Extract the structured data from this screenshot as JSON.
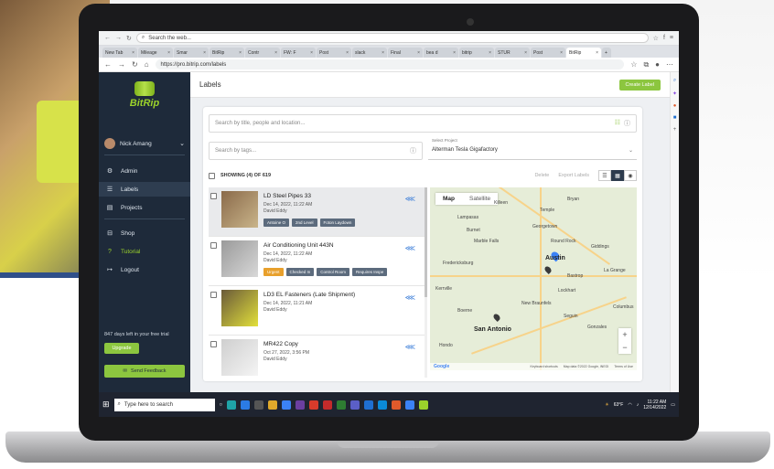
{
  "browser": {
    "top_address": "Search the web...",
    "tabs": [
      {
        "label": "New Tab",
        "active": false
      },
      {
        "label": "Mileage",
        "active": false
      },
      {
        "label": "Smar",
        "active": false
      },
      {
        "label": "BitRip",
        "active": false
      },
      {
        "label": "Contr",
        "active": false
      },
      {
        "label": "FW: F",
        "active": false
      },
      {
        "label": "Post",
        "active": false
      },
      {
        "label": "slack",
        "active": false
      },
      {
        "label": "Final",
        "active": false
      },
      {
        "label": "bea d",
        "active": false
      },
      {
        "label": "bitrip",
        "active": false
      },
      {
        "label": "STUR",
        "active": false
      },
      {
        "label": "Post",
        "active": false
      },
      {
        "label": "BitRip",
        "active": true
      }
    ],
    "url": "https://pro.bitrip.com/labels"
  },
  "sidebar": {
    "logo": "BitRip",
    "user_name": "Nick Amang",
    "nav": [
      {
        "label": "Admin",
        "icon": "admin-icon"
      },
      {
        "label": "Labels",
        "icon": "list-icon"
      },
      {
        "label": "Projects",
        "icon": "clipboard-icon"
      },
      {
        "label": "Shop",
        "icon": "shop-icon"
      },
      {
        "label": "Tutorial",
        "icon": "help-icon"
      },
      {
        "label": "Logout",
        "icon": "logout-icon"
      }
    ],
    "trial_text": "847 days left in your free trial",
    "upgrade_label": "Upgrade",
    "feedback_label": "Send Feedback"
  },
  "header": {
    "title": "Labels",
    "create_label": "Create Label"
  },
  "filters": {
    "search_placeholder": "Search by title, people and location...",
    "tags_placeholder": "Search by tags...",
    "project_label": "Select Project",
    "project_value": "Alterman Tesla Gigafactory"
  },
  "toolbar": {
    "showing": "SHOWING (4) OF 619",
    "delete_label": "Delete",
    "export_label": "Export Labels"
  },
  "labels": [
    {
      "title": "LD Steel Pipes 33",
      "date": "Dec 14, 2022, 11:22 AM",
      "author": "David Eddy",
      "tags": [
        "Antoine O",
        "2nd Level",
        "Foton Laydown"
      ],
      "selected": true
    },
    {
      "title": "Air Conditioning Unit 443N",
      "date": "Dec 14, 2022, 11:22 AM",
      "author": "David Eddy",
      "tags": [
        "Urgent",
        "Checked In",
        "Control Room",
        "Requires Inspe"
      ],
      "selected": false
    },
    {
      "title": "LD3 EL Fasteners (Late Shipment)",
      "date": "Dec 14, 2022, 11:21 AM",
      "author": "David Eddy",
      "tags": [],
      "selected": false
    },
    {
      "title": "MR422 Copy",
      "date": "Oct 27, 2022, 3:56 PM",
      "author": "David Eddy",
      "tags": [],
      "selected": false
    }
  ],
  "map": {
    "tab_map": "Map",
    "tab_satellite": "Satellite",
    "cities": [
      "Bryan",
      "Round Rock",
      "Austin",
      "San Antonio",
      "Killeen",
      "Temple",
      "Georgetown",
      "Marble Falls",
      "Fredericksburg",
      "Kerrville",
      "Bastrop",
      "La Grange",
      "New Braunfels",
      "Seguin",
      "Boerne",
      "Lockhart",
      "Gonzales",
      "Hondo",
      "Columbus",
      "Giddings",
      "Lampasas",
      "Burnet"
    ],
    "footer": [
      "Keyboard shortcuts",
      "Map data ©2022 Google, INEGI",
      "Terms of Use"
    ],
    "google": "Google"
  },
  "taskbar": {
    "search": "Type here to search",
    "temp": "63°F",
    "time": "11:22 AM",
    "date": "12/14/2022"
  }
}
